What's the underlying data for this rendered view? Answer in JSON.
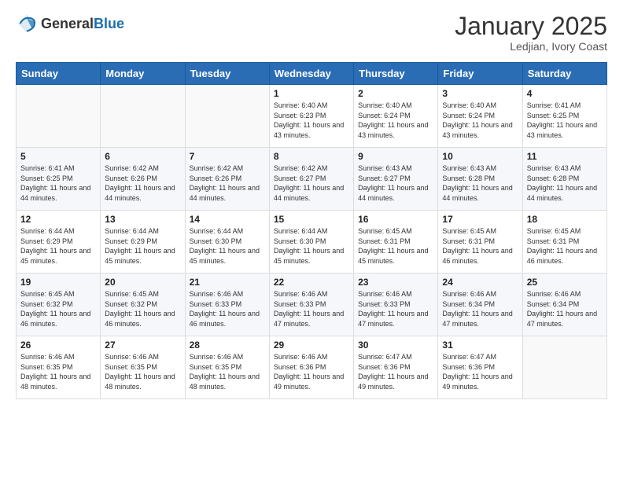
{
  "logo": {
    "general": "General",
    "blue": "Blue"
  },
  "title": "January 2025",
  "location": "Ledjian, Ivory Coast",
  "days_of_week": [
    "Sunday",
    "Monday",
    "Tuesday",
    "Wednesday",
    "Thursday",
    "Friday",
    "Saturday"
  ],
  "weeks": [
    [
      {
        "day": "",
        "sunrise": "",
        "sunset": "",
        "daylight": ""
      },
      {
        "day": "",
        "sunrise": "",
        "sunset": "",
        "daylight": ""
      },
      {
        "day": "",
        "sunrise": "",
        "sunset": "",
        "daylight": ""
      },
      {
        "day": "1",
        "sunrise": "Sunrise: 6:40 AM",
        "sunset": "Sunset: 6:23 PM",
        "daylight": "Daylight: 11 hours and 43 minutes."
      },
      {
        "day": "2",
        "sunrise": "Sunrise: 6:40 AM",
        "sunset": "Sunset: 6:24 PM",
        "daylight": "Daylight: 11 hours and 43 minutes."
      },
      {
        "day": "3",
        "sunrise": "Sunrise: 6:40 AM",
        "sunset": "Sunset: 6:24 PM",
        "daylight": "Daylight: 11 hours and 43 minutes."
      },
      {
        "day": "4",
        "sunrise": "Sunrise: 6:41 AM",
        "sunset": "Sunset: 6:25 PM",
        "daylight": "Daylight: 11 hours and 43 minutes."
      }
    ],
    [
      {
        "day": "5",
        "sunrise": "Sunrise: 6:41 AM",
        "sunset": "Sunset: 6:25 PM",
        "daylight": "Daylight: 11 hours and 44 minutes."
      },
      {
        "day": "6",
        "sunrise": "Sunrise: 6:42 AM",
        "sunset": "Sunset: 6:26 PM",
        "daylight": "Daylight: 11 hours and 44 minutes."
      },
      {
        "day": "7",
        "sunrise": "Sunrise: 6:42 AM",
        "sunset": "Sunset: 6:26 PM",
        "daylight": "Daylight: 11 hours and 44 minutes."
      },
      {
        "day": "8",
        "sunrise": "Sunrise: 6:42 AM",
        "sunset": "Sunset: 6:27 PM",
        "daylight": "Daylight: 11 hours and 44 minutes."
      },
      {
        "day": "9",
        "sunrise": "Sunrise: 6:43 AM",
        "sunset": "Sunset: 6:27 PM",
        "daylight": "Daylight: 11 hours and 44 minutes."
      },
      {
        "day": "10",
        "sunrise": "Sunrise: 6:43 AM",
        "sunset": "Sunset: 6:28 PM",
        "daylight": "Daylight: 11 hours and 44 minutes."
      },
      {
        "day": "11",
        "sunrise": "Sunrise: 6:43 AM",
        "sunset": "Sunset: 6:28 PM",
        "daylight": "Daylight: 11 hours and 44 minutes."
      }
    ],
    [
      {
        "day": "12",
        "sunrise": "Sunrise: 6:44 AM",
        "sunset": "Sunset: 6:29 PM",
        "daylight": "Daylight: 11 hours and 45 minutes."
      },
      {
        "day": "13",
        "sunrise": "Sunrise: 6:44 AM",
        "sunset": "Sunset: 6:29 PM",
        "daylight": "Daylight: 11 hours and 45 minutes."
      },
      {
        "day": "14",
        "sunrise": "Sunrise: 6:44 AM",
        "sunset": "Sunset: 6:30 PM",
        "daylight": "Daylight: 11 hours and 45 minutes."
      },
      {
        "day": "15",
        "sunrise": "Sunrise: 6:44 AM",
        "sunset": "Sunset: 6:30 PM",
        "daylight": "Daylight: 11 hours and 45 minutes."
      },
      {
        "day": "16",
        "sunrise": "Sunrise: 6:45 AM",
        "sunset": "Sunset: 6:31 PM",
        "daylight": "Daylight: 11 hours and 45 minutes."
      },
      {
        "day": "17",
        "sunrise": "Sunrise: 6:45 AM",
        "sunset": "Sunset: 6:31 PM",
        "daylight": "Daylight: 11 hours and 46 minutes."
      },
      {
        "day": "18",
        "sunrise": "Sunrise: 6:45 AM",
        "sunset": "Sunset: 6:31 PM",
        "daylight": "Daylight: 11 hours and 46 minutes."
      }
    ],
    [
      {
        "day": "19",
        "sunrise": "Sunrise: 6:45 AM",
        "sunset": "Sunset: 6:32 PM",
        "daylight": "Daylight: 11 hours and 46 minutes."
      },
      {
        "day": "20",
        "sunrise": "Sunrise: 6:45 AM",
        "sunset": "Sunset: 6:32 PM",
        "daylight": "Daylight: 11 hours and 46 minutes."
      },
      {
        "day": "21",
        "sunrise": "Sunrise: 6:46 AM",
        "sunset": "Sunset: 6:33 PM",
        "daylight": "Daylight: 11 hours and 46 minutes."
      },
      {
        "day": "22",
        "sunrise": "Sunrise: 6:46 AM",
        "sunset": "Sunset: 6:33 PM",
        "daylight": "Daylight: 11 hours and 47 minutes."
      },
      {
        "day": "23",
        "sunrise": "Sunrise: 6:46 AM",
        "sunset": "Sunset: 6:33 PM",
        "daylight": "Daylight: 11 hours and 47 minutes."
      },
      {
        "day": "24",
        "sunrise": "Sunrise: 6:46 AM",
        "sunset": "Sunset: 6:34 PM",
        "daylight": "Daylight: 11 hours and 47 minutes."
      },
      {
        "day": "25",
        "sunrise": "Sunrise: 6:46 AM",
        "sunset": "Sunset: 6:34 PM",
        "daylight": "Daylight: 11 hours and 47 minutes."
      }
    ],
    [
      {
        "day": "26",
        "sunrise": "Sunrise: 6:46 AM",
        "sunset": "Sunset: 6:35 PM",
        "daylight": "Daylight: 11 hours and 48 minutes."
      },
      {
        "day": "27",
        "sunrise": "Sunrise: 6:46 AM",
        "sunset": "Sunset: 6:35 PM",
        "daylight": "Daylight: 11 hours and 48 minutes."
      },
      {
        "day": "28",
        "sunrise": "Sunrise: 6:46 AM",
        "sunset": "Sunset: 6:35 PM",
        "daylight": "Daylight: 11 hours and 48 minutes."
      },
      {
        "day": "29",
        "sunrise": "Sunrise: 6:46 AM",
        "sunset": "Sunset: 6:36 PM",
        "daylight": "Daylight: 11 hours and 49 minutes."
      },
      {
        "day": "30",
        "sunrise": "Sunrise: 6:47 AM",
        "sunset": "Sunset: 6:36 PM",
        "daylight": "Daylight: 11 hours and 49 minutes."
      },
      {
        "day": "31",
        "sunrise": "Sunrise: 6:47 AM",
        "sunset": "Sunset: 6:36 PM",
        "daylight": "Daylight: 11 hours and 49 minutes."
      },
      {
        "day": "",
        "sunrise": "",
        "sunset": "",
        "daylight": ""
      }
    ]
  ]
}
